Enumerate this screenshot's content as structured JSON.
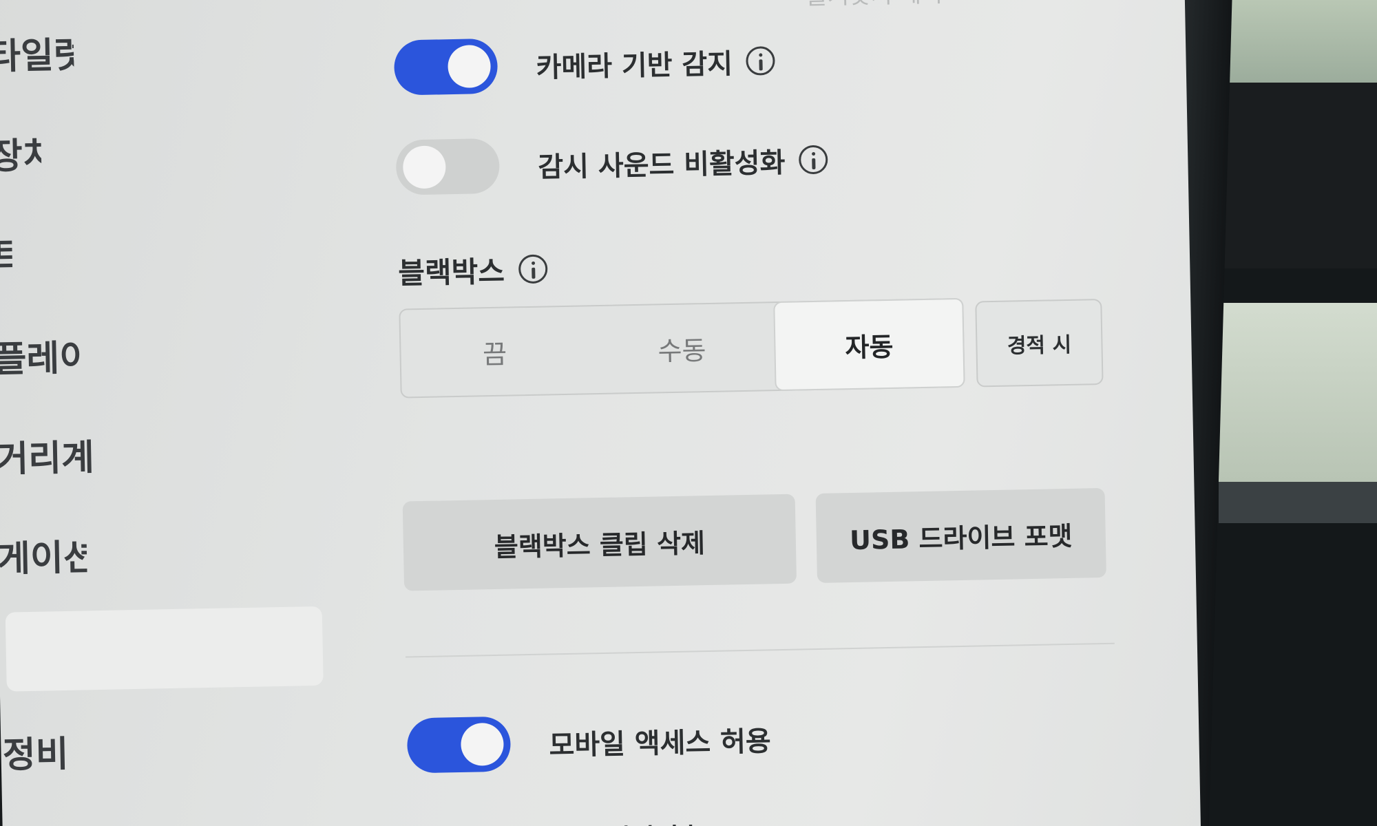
{
  "sidebar": {
    "items": [
      {
        "label": "타일럿"
      },
      {
        "label": "장치"
      },
      {
        "label": "트"
      },
      {
        "label": "플레이"
      },
      {
        "label": "거리계"
      },
      {
        "label": "게이션"
      },
      {
        "label": ""
      },
      {
        "label": "정비"
      }
    ]
  },
  "header": {
    "faded_text": "즐겨찾기 제외"
  },
  "settings": {
    "camera_detection": {
      "label": "카메라 기반 감지",
      "enabled": true
    },
    "sentry_sound": {
      "label": "감시 사운드 비활성화",
      "enabled": false
    },
    "dashcam": {
      "title": "블랙박스",
      "options": [
        "끔",
        "수동",
        "자동"
      ],
      "selected": "자동",
      "on_honk": "경적 시"
    },
    "actions": {
      "delete_clips": "블랙박스 클립 삭제",
      "format_usb": "USB 드라이브 포맷"
    },
    "mobile_access": {
      "label": "모바일 액세스 허용",
      "enabled": true
    },
    "next_row_partial": "PIN 비밀번호"
  },
  "colors": {
    "toggle_on": "#2b55dc",
    "toggle_off": "#cfd1d0",
    "screen_bg": "#e4e6e5"
  },
  "icons": [
    "info-icon"
  ]
}
